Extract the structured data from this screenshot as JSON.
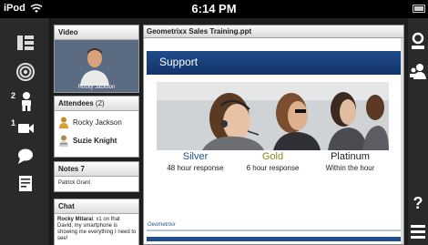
{
  "status_bar": {
    "carrier": "iPod",
    "time": "6:14 PM"
  },
  "left_toolbar": {
    "attendee_badge": "2",
    "camera_badge": "1",
    "icons": [
      "grid-layout-icon",
      "broadcast-status-icon",
      "attendees-icon",
      "camera-icon",
      "chat-bubble-icon",
      "notes-icon"
    ]
  },
  "video_pod": {
    "title": "Video",
    "caption": "Rocky Jackson"
  },
  "attendees_pod": {
    "title": "Attendees",
    "count": "(2)",
    "attendees": [
      {
        "name": "Rocky Jackson",
        "bold": false
      },
      {
        "name": "Suzie Knight",
        "bold": true
      }
    ]
  },
  "notes_pod": {
    "title": "Notes 7",
    "text": "Patrick Grant"
  },
  "chat_pod": {
    "title": "Chat",
    "message_author": "Rocky Mitarai",
    "message_text": ": x1 on that David, my smartphone is showing me everything I need to see!"
  },
  "share_pod": {
    "title": "Geometrixx Sales Training.ppt",
    "slide": {
      "heading": "Support",
      "tiers": [
        {
          "name": "Silver",
          "desc": "48 hour response",
          "color": "#1f4c8c"
        },
        {
          "name": "Gold",
          "desc": "6 hour response",
          "color": "#8a8a1a"
        },
        {
          "name": "Platinum",
          "desc": "Within the hour",
          "color": "#222222"
        }
      ],
      "footer_logo": "Geometrixx"
    }
  },
  "right_toolbar": {
    "help_label": "?",
    "icons": [
      "profile-icon",
      "users-icon",
      "help-icon",
      "menu-icon"
    ]
  },
  "colors": {
    "slide_blue": "#1f4c8c",
    "toolbar_bg": "#2a2a2a"
  }
}
